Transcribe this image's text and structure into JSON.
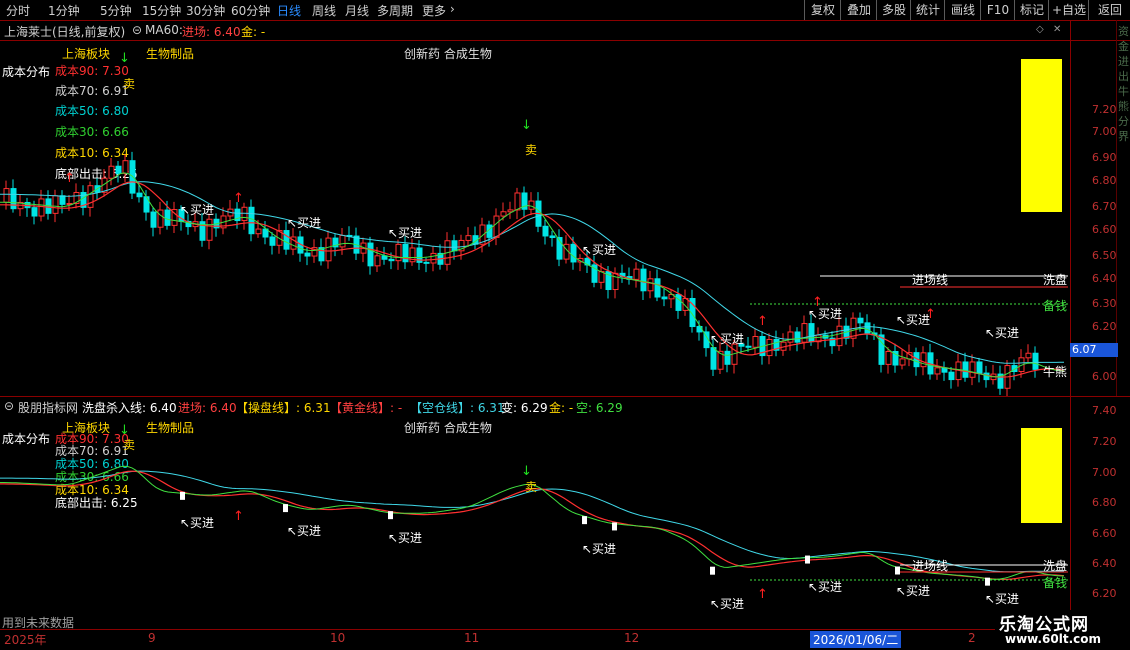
{
  "toolbar": {
    "periods": [
      "分时",
      "1分钟",
      "5分钟",
      "15分钟",
      "30分钟",
      "60分钟",
      "日线",
      "周线",
      "月线",
      "多周期",
      "更多"
    ],
    "active_period": "日线",
    "right_buttons": [
      "复权",
      "叠加",
      "多股",
      "统计",
      "画线",
      "F10",
      "标记",
      "+自选",
      "返回"
    ]
  },
  "main_chart": {
    "stock_title": "上海莱士(日线,前复权)",
    "ma_label": "MA60:",
    "entry_label": "进场: 6.40",
    "gold_label": "金: -",
    "sector_label": "上海板块",
    "product_label": "生物制品",
    "concept_label": "创新药 合成生物",
    "cost_dist_label": "成本分布",
    "costs": [
      "成本90: 7.30",
      "成本70: 6.91",
      "成本50: 6.80",
      "成本30: 6.66",
      "成本10: 6.34"
    ],
    "bottom_out": "底部出击: 6.25",
    "y_ticks": [
      "7.20",
      "7.10",
      "7.00",
      "6.90",
      "6.80",
      "6.70",
      "6.60",
      "6.50",
      "6.40",
      "6.30",
      "6.20",
      "6.10",
      "6.00"
    ],
    "current_price": "6.07",
    "sell_label": "卖",
    "buy_label": "↖买进",
    "entry_line_label": "进场线",
    "wash_label": "洗盘",
    "prepare_label": "备钱",
    "bull_label": "牛熊",
    "right_strip_text": "资金进出牛熊分界"
  },
  "sub_chart": {
    "indicator_name": "股朋指标网",
    "wash_kill_line": "洗盘杀入线: 6.40",
    "entry": "进场: 6.40",
    "operate_line": "【操盘线】: 6.31",
    "gold_line": "【黄金线】: -",
    "empty_line": "【空仓线】: 6.31",
    "change": "变: 6.29",
    "gold": "金: -",
    "empty": "空: 6.29",
    "y_ticks": [
      "7.40",
      "7.20",
      "7.00",
      "6.80",
      "6.60",
      "6.40",
      "6.20"
    ],
    "future_note": "用到未来数据"
  },
  "time_axis": {
    "labels": [
      "2025年",
      "9",
      "10",
      "11",
      "12",
      "2026/01/06/二",
      "2"
    ]
  },
  "brand": {
    "name": "乐淘公式网",
    "url": "www.60lt.com"
  },
  "colors": {
    "border": "#8a0000",
    "axis": "#c03030",
    "up": "#ff3030",
    "down": "#00e5e5",
    "ma_short": "#ffff60",
    "yellow": "#ffff00"
  }
}
